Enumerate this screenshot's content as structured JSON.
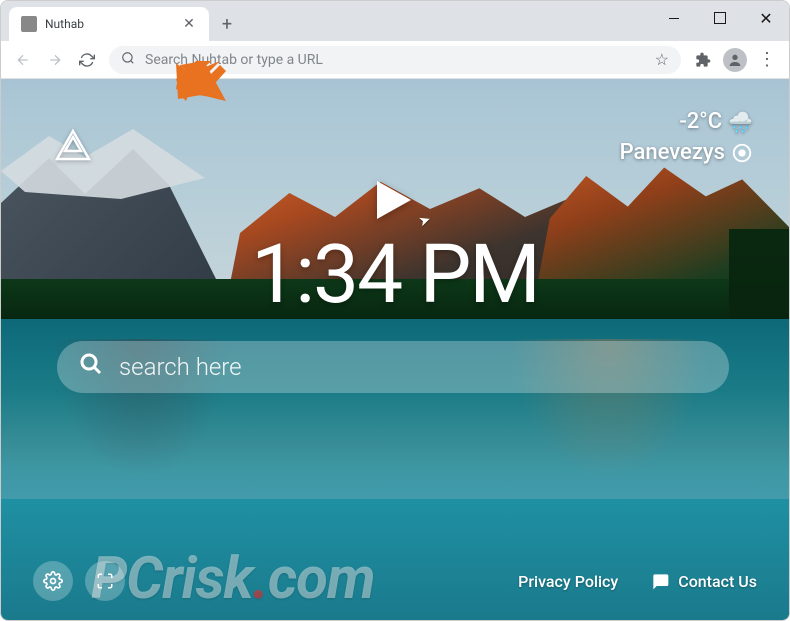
{
  "tab": {
    "title": "Nuthab"
  },
  "omnibox": {
    "placeholder": "Search Nuhtab or type a URL"
  },
  "weather": {
    "temp": "-2°C",
    "location": "Panevezys"
  },
  "clock": {
    "time": "1:34 PM"
  },
  "search": {
    "placeholder": "search here"
  },
  "footer": {
    "privacy": "Privacy Policy",
    "contact": "Contact Us"
  },
  "watermark": {
    "text_prefix": "PCrisk",
    "text_suffix": "com"
  },
  "icons": {
    "back": "back-icon",
    "forward": "forward-icon",
    "reload": "reload-icon",
    "search": "search-icon",
    "star": "star-icon",
    "extensions": "puzzle-icon",
    "profile": "profile-icon",
    "menu": "menu-icon",
    "close": "close-icon",
    "plus": "plus-icon",
    "minimize": "minimize-icon",
    "maximize": "maximize-icon",
    "logo": "triangle-logo-icon",
    "play": "play-icon",
    "weather": "rain-cloud-icon",
    "pin": "location-pin-icon",
    "settings": "gear-icon",
    "fullscreen": "fullscreen-icon",
    "chat": "chat-icon"
  }
}
